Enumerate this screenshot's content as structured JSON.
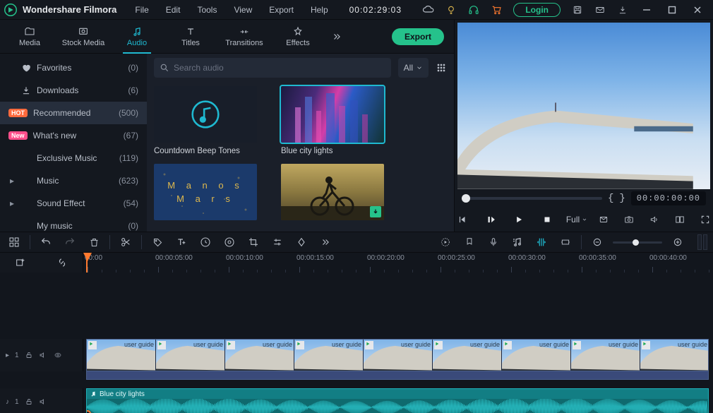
{
  "app": {
    "name": "Wondershare Filmora"
  },
  "menus": [
    "File",
    "Edit",
    "Tools",
    "View",
    "Export",
    "Help"
  ],
  "timecode": "00:02:29:03",
  "login": "Login",
  "tabs": [
    {
      "id": "media",
      "label": "Media"
    },
    {
      "id": "stock",
      "label": "Stock Media"
    },
    {
      "id": "audio",
      "label": "Audio"
    },
    {
      "id": "titles",
      "label": "Titles"
    },
    {
      "id": "transitions",
      "label": "Transitions"
    },
    {
      "id": "effects",
      "label": "Effects"
    }
  ],
  "export_label": "Export",
  "sidebar": [
    {
      "icon": "heart",
      "label": "Favorites",
      "count": "(0)"
    },
    {
      "icon": "download",
      "label": "Downloads",
      "count": "(6)"
    },
    {
      "tag": "HOT",
      "tagClass": "hot",
      "label": "Recommended",
      "count": "(500)",
      "active": true
    },
    {
      "tag": "New",
      "tagClass": "new",
      "label": "What's new",
      "count": "(67)"
    },
    {
      "indent": true,
      "label": "Exclusive Music",
      "count": "(119)"
    },
    {
      "caret": true,
      "label": "Music",
      "count": "(623)"
    },
    {
      "caret": true,
      "label": "Sound Effect",
      "count": "(54)"
    },
    {
      "indent": true,
      "label": "My music",
      "count": "(0)"
    }
  ],
  "search": {
    "placeholder": "Search audio"
  },
  "filter": {
    "label": "All"
  },
  "thumbs": [
    {
      "id": "countdown",
      "label": "Countdown Beep Tones"
    },
    {
      "id": "bluecity",
      "label": "Blue city lights",
      "selected": true
    },
    {
      "id": "manos",
      "label": ""
    },
    {
      "id": "cyclist",
      "label": "",
      "download": true
    }
  ],
  "thumb_art": {
    "manos_l1": "M a n o s",
    "manos_l2": "M a r s"
  },
  "preview": {
    "timecode": "00:00:00:00",
    "quality": "Full"
  },
  "ruler": [
    "00:00",
    "00:00:05:00",
    "00:00:10:00",
    "00:00:15:00",
    "00:00:20:00",
    "00:00:25:00",
    "00:00:30:00",
    "00:00:35:00",
    "00:00:40:00"
  ],
  "tracks": {
    "video": {
      "label_prefix": "▸",
      "index": "1"
    },
    "audio": {
      "label_prefix": "♪",
      "index": "1"
    }
  },
  "clip_label": "user guide",
  "audio_clip": {
    "title": "Blue city lights"
  }
}
